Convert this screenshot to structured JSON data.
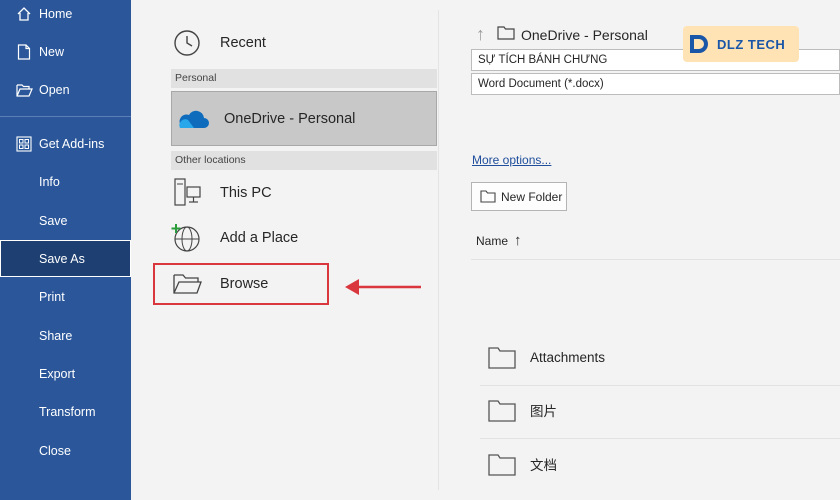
{
  "nav": {
    "home": "Home",
    "new": "New",
    "open": "Open",
    "get_addins": "Get Add-ins",
    "info": "Info",
    "save": "Save",
    "save_as": "Save As",
    "print": "Print",
    "share": "Share",
    "export": "Export",
    "transform": "Transform",
    "close": "Close"
  },
  "locations": {
    "recent": "Recent",
    "personal_header": "Personal",
    "onedrive": "OneDrive - Personal",
    "other_header": "Other locations",
    "this_pc": "This PC",
    "add_place": "Add a Place",
    "browse": "Browse"
  },
  "file_pane": {
    "path": "OneDrive - Personal",
    "filename": "SỰ TÍCH BÁNH CHƯNG",
    "file_type": "Word Document (*.docx)",
    "more_options": "More options...",
    "new_folder": "New Folder",
    "name_header": "Name",
    "folders": [
      "Attachments",
      "图片",
      "文档"
    ]
  },
  "watermark": {
    "text": "DLZ TECH"
  },
  "colors": {
    "nav_bg": "#2b579a",
    "accent_red": "#d9363e",
    "onedrive_blue": "#0f6cbd"
  }
}
